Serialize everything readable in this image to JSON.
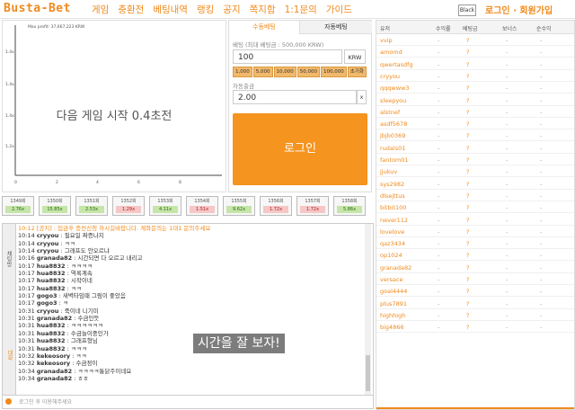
{
  "header": {
    "logo": "Busta-Bet",
    "nav": [
      "게임",
      "충환전",
      "베팅내역",
      "랭킹",
      "공지",
      "쪽지함",
      "1:1문의",
      "가이드"
    ],
    "theme_button": "Black",
    "auth": "로그인 · 회원가입"
  },
  "chart": {
    "max_profit": "Max profit: 37,667,223 KRW",
    "countdown": "다음 게임 시작 0.4초전",
    "y_ticks": [
      "1.4x",
      "1.4x",
      "1.4x",
      "1.2x"
    ],
    "x_ticks": [
      "0",
      "2",
      "4",
      "6",
      "8"
    ]
  },
  "bet_panel": {
    "tab_manual": "수동베팅",
    "tab_auto": "자동베팅",
    "bet_label": "베팅 (최대 베팅금 : 500,000 KRW)",
    "bet_value": "100",
    "currency": "KRW",
    "chips": [
      "1,000",
      "5,000",
      "10,000",
      "50,000",
      "100,000",
      "초기화"
    ],
    "cashout_label": "자동출금",
    "cashout_value": "2.00",
    "cashout_suffix": "x",
    "login_button": "로그인"
  },
  "history": [
    {
      "id": "1349회",
      "val": "2.76x",
      "win": true
    },
    {
      "id": "1350회",
      "val": "15.85x",
      "win": true
    },
    {
      "id": "1351회",
      "val": "2.53x",
      "win": true
    },
    {
      "id": "1352회",
      "val": "1.29x",
      "win": false
    },
    {
      "id": "1353회",
      "val": "4.11x",
      "win": true
    },
    {
      "id": "1354회",
      "val": "1.51x",
      "win": false
    },
    {
      "id": "1355회",
      "val": "9.62x",
      "win": true
    },
    {
      "id": "1356회",
      "val": "1.72x",
      "win": false
    },
    {
      "id": "1357회",
      "val": "1.72x",
      "win": false
    },
    {
      "id": "1358회",
      "val": "5.86x",
      "win": true
    }
  ],
  "chat": {
    "side_tab_1": "채팅방",
    "side_tab_2": "대화",
    "notice": "10:12 [공지] : 입금후 충전신청 하시길바랍니다. 계좌문의는 1대1 문의주세요",
    "messages": [
      {
        "time": "10:14",
        "user": "cryyou",
        "text": "필요일 짜증나지"
      },
      {
        "time": "10:14",
        "user": "cryyou",
        "text": "ㅋㅋ"
      },
      {
        "time": "10:14",
        "user": "cryyou",
        "text": "그래프도 안오르냐"
      },
      {
        "time": "10:16",
        "user": "granada82",
        "text": "시간되면 다 오르고 내리고"
      },
      {
        "time": "10:17",
        "user": "hua8832",
        "text": "ㅋㅋㅋㅋ"
      },
      {
        "time": "10:17",
        "user": "hua8832",
        "text": "역록계속"
      },
      {
        "time": "10:17",
        "user": "hua8832",
        "text": "시작이네"
      },
      {
        "time": "10:17",
        "user": "hua8832",
        "text": "ㅋㅋ"
      },
      {
        "time": "10:17",
        "user": "gogo3",
        "text": "새벽타임때 그림이 좋았음"
      },
      {
        "time": "10:17",
        "user": "gogo3",
        "text": "ㅋ"
      },
      {
        "time": "10:31",
        "user": "cryyou",
        "text": "죽이네 니기미"
      },
      {
        "time": "10:31",
        "user": "granada82",
        "text": "수금인듯"
      },
      {
        "time": "10:31",
        "user": "hua8832",
        "text": "ㅋㅋㅋㅋㅋㅋ"
      },
      {
        "time": "10:31",
        "user": "hua8832",
        "text": "수금놀이중인가"
      },
      {
        "time": "10:31",
        "user": "hua8832",
        "text": "그래프형님"
      },
      {
        "time": "10:31",
        "user": "hua8832",
        "text": "ㅋㅋㅋ"
      },
      {
        "time": "10:32",
        "user": "kekeosory",
        "text": "ㅋㅋ"
      },
      {
        "time": "10:32",
        "user": "kekeosory",
        "text": "수금정이"
      },
      {
        "time": "10:34",
        "user": "granada82",
        "text": "ㅋㅋㅋㅋ통닭주이네요"
      },
      {
        "time": "10:34",
        "user": "granada82",
        "text": "ㅎㅎ"
      }
    ],
    "overlay": "시간을 잘 보자!",
    "input_placeholder": "로그인 후 이용해주세요"
  },
  "users": {
    "headers": [
      "유저",
      "수익률",
      "베팅금",
      "보너스",
      "순수익"
    ],
    "rows": [
      "vvip",
      "amomd",
      "qwertasdfg",
      "cryyou",
      "qqqwww3",
      "sleepyou",
      "alstnef",
      "asdf5678",
      "jbjb0369",
      "rudals01",
      "fantom01",
      "jjukuv",
      "sys2982",
      "dlsejttus",
      "bitbit100",
      "never112",
      "lovelove",
      "qaz3434",
      "op1024",
      "granada82",
      "versace",
      "goal4444",
      "plus7891",
      "highhigh",
      "big4866"
    ],
    "dash": "-",
    "question": "?"
  }
}
